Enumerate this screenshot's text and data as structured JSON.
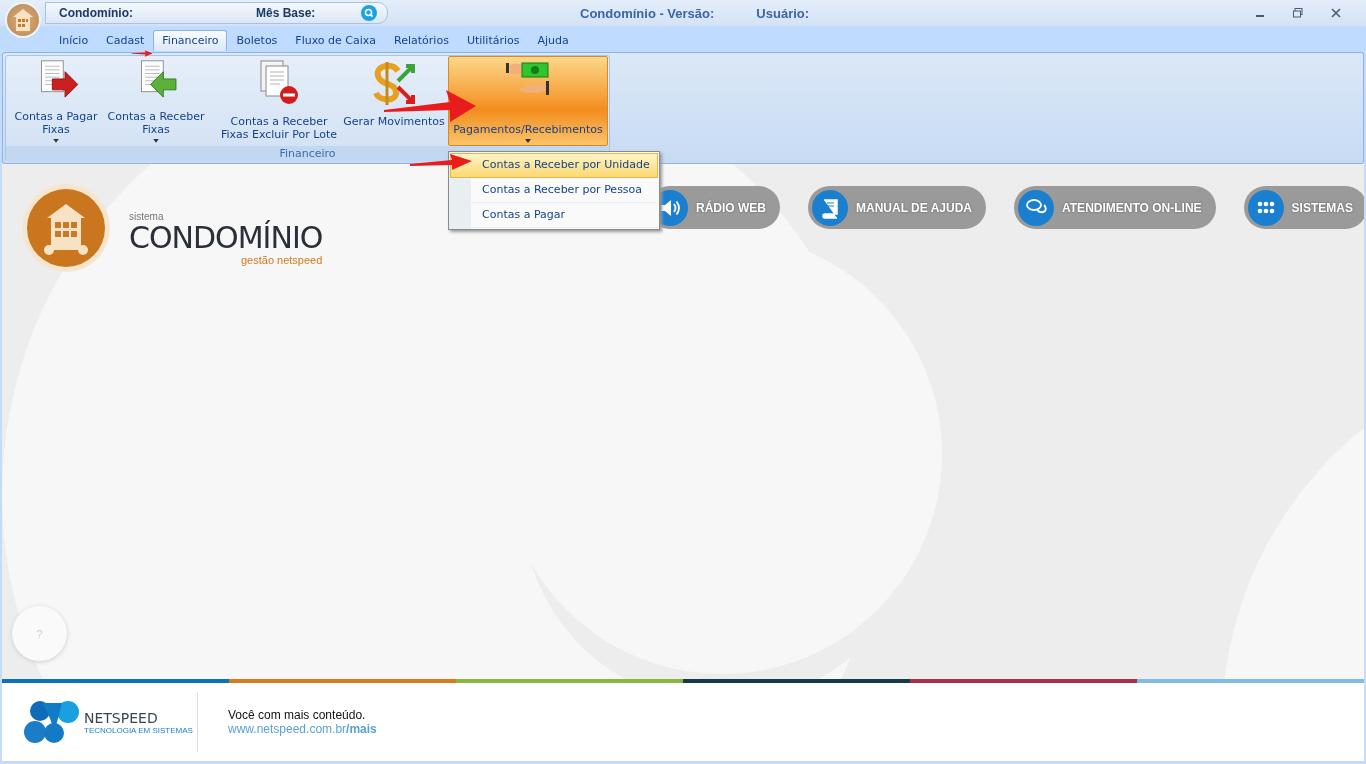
{
  "window": {
    "condominio_label": "Condomínio:",
    "mes_base_label": "Mês Base:",
    "title": "Condomínio - Versão:",
    "user_label": "Usuário:"
  },
  "tabs": [
    {
      "label": "Início",
      "selected": false
    },
    {
      "label": "Cadast",
      "selected": false
    },
    {
      "label": "Financeiro",
      "selected": true
    },
    {
      "label": "Boletos",
      "selected": false
    },
    {
      "label": "Fluxo de Caixa",
      "selected": false
    },
    {
      "label": "Relatórios",
      "selected": false
    },
    {
      "label": "Utilitários",
      "selected": false
    },
    {
      "label": "Ajuda",
      "selected": false
    }
  ],
  "ribbon": {
    "group_label": "Financeiro",
    "buttons": [
      {
        "kind": "pay",
        "lines": [
          "Contas a Pagar",
          "Fixas"
        ],
        "dropdown": true,
        "highlighted": false
      },
      {
        "kind": "receive",
        "lines": [
          "Contas a Receber",
          "Fixas"
        ],
        "dropdown": true,
        "highlighted": false
      },
      {
        "kind": "delete",
        "lines": [
          "Contas a Receber",
          "Fixas Excluir Por Lote"
        ],
        "dropdown": false,
        "highlighted": false
      },
      {
        "kind": "generate",
        "lines": [
          "Gerar Movimentos"
        ],
        "dropdown": false,
        "highlighted": false
      },
      {
        "kind": "payments",
        "lines": [
          "Pagamentos/Recebimentos"
        ],
        "dropdown": true,
        "highlighted": true
      }
    ]
  },
  "menu": {
    "items": [
      {
        "label": "Contas a Receber por Unidade",
        "selected": true
      },
      {
        "label": "Contas a Receber por Pessoa",
        "selected": false
      },
      {
        "label": "Contas a Pagar",
        "selected": false
      }
    ]
  },
  "brand": {
    "small": "sistema",
    "name": "CONDOMÍNIO",
    "tagline": "gestão netspeed"
  },
  "links": [
    {
      "kind": "radio",
      "label": "RÁDIO WEB"
    },
    {
      "kind": "manual",
      "label": "MANUAL DE AJUDA"
    },
    {
      "kind": "chat",
      "label": "ATENDIMENTO ON-LINE"
    },
    {
      "kind": "systems",
      "label": "SISTEMAS"
    }
  ],
  "help_button": {
    "label": "?"
  },
  "footer": {
    "logo_name": "NETSPEED",
    "logo_tagline": "TECNOLOGIA EM SISTEMAS",
    "text": "Você com mais conteúdo.",
    "link": "www.netspeed.com.br**/mais**"
  }
}
